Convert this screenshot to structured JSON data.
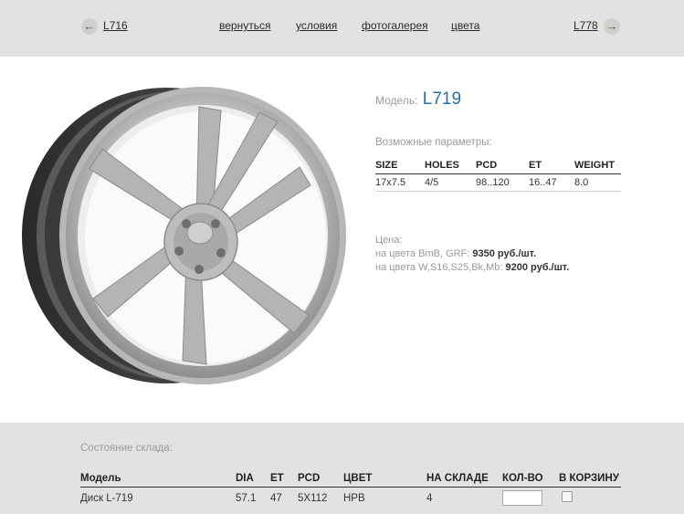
{
  "header": {
    "prev_model": "L716",
    "next_model": "L778",
    "prev_arrow": "←",
    "next_arrow": "→",
    "links": [
      "вернуться",
      "условия",
      "фотогалерея",
      "цвета"
    ]
  },
  "product": {
    "model_label": "Модель:",
    "model_name": "L719",
    "params_label": "Возможные параметры:",
    "params_headers": [
      "SIZE",
      "HOLES",
      "PCD",
      "ET",
      "WEIGHT"
    ],
    "params_row": [
      "17x7.5",
      "4/5",
      "98..120",
      "16..47",
      "8.0"
    ],
    "price_label": "Цена:",
    "prices": [
      {
        "text": "на цвета BmB, GRF: ",
        "value": "9350 руб./шт."
      },
      {
        "text": "на цвета W,S16,S25,Bk,Mb: ",
        "value": "9200 руб./шт."
      }
    ],
    "image_icon": "alloy-wheel-image"
  },
  "stock": {
    "label": "Состояние склада:",
    "headers": [
      "Модель",
      "DIA",
      "ET",
      "PCD",
      "ЦВЕТ",
      "НА СКЛАДЕ",
      "КОЛ-ВО",
      "В КОРЗИНУ"
    ],
    "row": [
      "Диск L-719",
      "57.1",
      "47",
      "5X112",
      "HPB",
      "4"
    ],
    "quantity_value": ""
  },
  "colors": {
    "header_bg": "#e2e2e0",
    "model_accent": "#2b6e9a"
  }
}
